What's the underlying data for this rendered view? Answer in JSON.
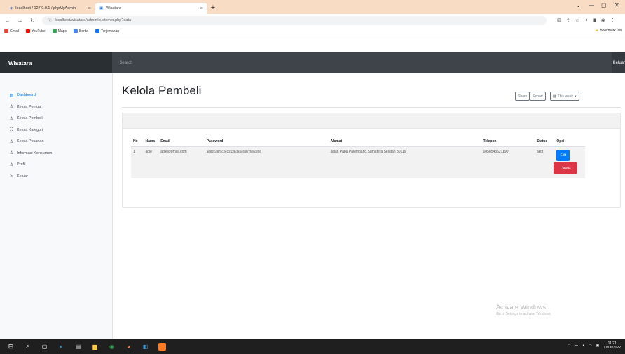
{
  "browser": {
    "tabs": [
      {
        "title": "localhost / 127.0.0.1 / phpMyAdmin"
      },
      {
        "title": "Wisatara"
      }
    ],
    "new_tab": "+",
    "window_controls": [
      "⌄",
      "—",
      "▢",
      "✕"
    ],
    "url": "localhost/wisatara/admin/customer.php?data",
    "bookmarks": [
      {
        "label": "Gmail",
        "color": "#ea4335"
      },
      {
        "label": "YouTube",
        "color": "#ff0000"
      },
      {
        "label": "Maps",
        "color": "#34a853"
      },
      {
        "label": "Berita",
        "color": "#4285f4"
      },
      {
        "label": "Terjemahan",
        "color": "#1a73e8"
      }
    ],
    "bookmarks_right": "Bookmark lain"
  },
  "navbar": {
    "brand": "Wisatara",
    "search_placeholder": "Search",
    "signout": "Keluar"
  },
  "sidebar": {
    "items": [
      {
        "label": "Dashboard",
        "icon": "▤",
        "active": true
      },
      {
        "label": "Kelola Penjual",
        "icon": "♙",
        "active": false
      },
      {
        "label": "Kelola Pembeli",
        "icon": "♙",
        "active": false
      },
      {
        "label": "Kelola Kategori",
        "icon": "☷",
        "active": false
      },
      {
        "label": "Kelola Pesanan",
        "icon": "♙",
        "active": false
      },
      {
        "label": "Informasi Konsumen",
        "icon": "♙",
        "active": false
      },
      {
        "label": "Profil",
        "icon": "♙",
        "active": false
      },
      {
        "label": "Keluar",
        "icon": "⇲",
        "active": false
      }
    ]
  },
  "main": {
    "title": "Kelola Pembeli",
    "buttons": {
      "share": "Share",
      "export": "Export",
      "range": "This week"
    },
    "table": {
      "headers": [
        "No",
        "Nama",
        "Email",
        "Password",
        "Alamat",
        "Telepon",
        "Status",
        "Opsi"
      ],
      "rows": [
        {
          "no": "1",
          "nama": "adie",
          "email": "adie@gmail.com",
          "password": "a662ca6f7c2e12136da5c69b759fc206",
          "alamat": "Jalan Papu Palembang,Sumatera Selatan 30119",
          "telepon": "0858543621190",
          "status": "aktif",
          "edit": "Edit",
          "hapus": "Hapus"
        }
      ]
    }
  },
  "watermark": {
    "line1": "Activate Windows",
    "line2": "Go to Settings to activate Windows."
  },
  "taskbar": {
    "time": "11.21",
    "date": "11/06/2022"
  }
}
